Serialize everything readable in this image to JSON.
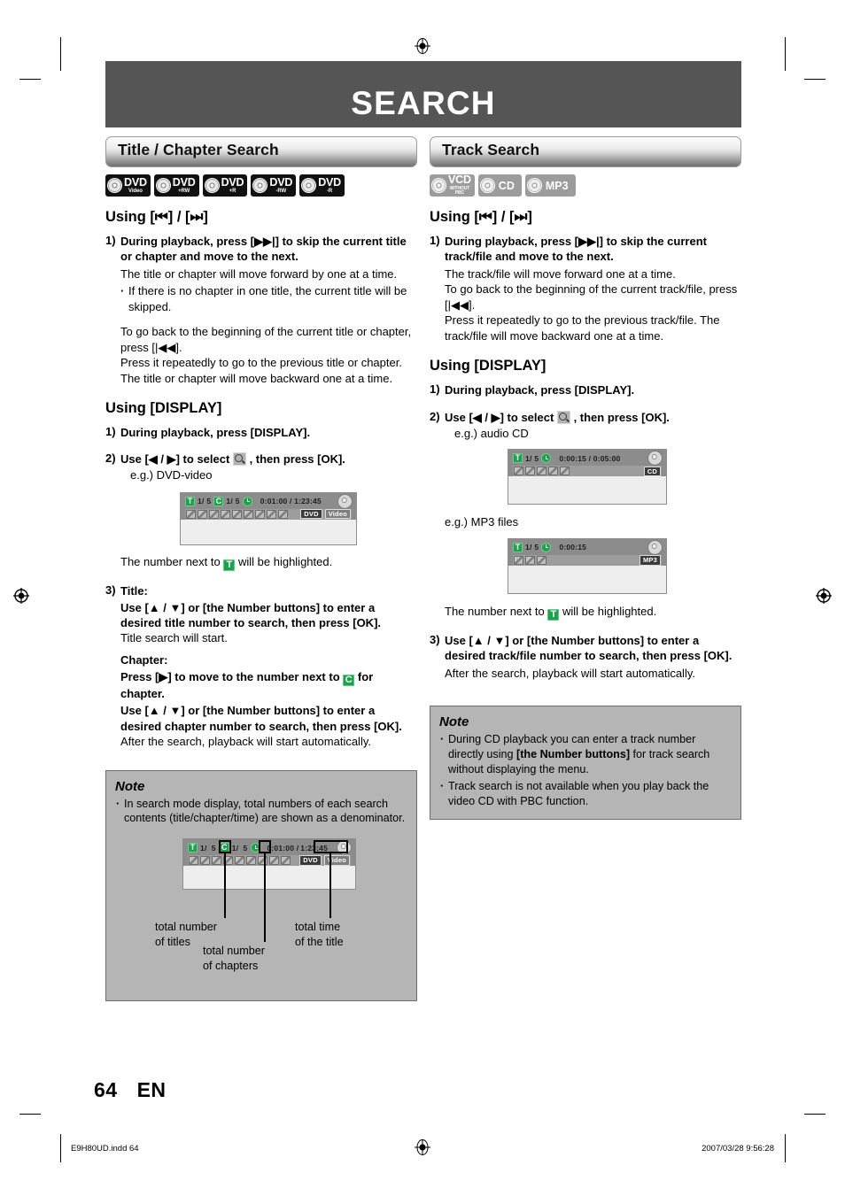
{
  "page": {
    "banner_title": "SEARCH",
    "page_number": "64",
    "language_code": "EN",
    "footer_left": "E9H80UD.indd   64",
    "footer_right": "2007/03/28   9:56:28"
  },
  "left_column": {
    "section_title": "Title / Chapter Search",
    "badges": [
      {
        "main": "DVD",
        "sub": "Video",
        "style": "dark"
      },
      {
        "main": "DVD",
        "sub": "+RW",
        "style": "dark"
      },
      {
        "main": "DVD",
        "sub": "+R",
        "style": "dark"
      },
      {
        "main": "DVD",
        "sub": "-RW",
        "style": "dark"
      },
      {
        "main": "DVD",
        "sub": "-R",
        "style": "dark"
      }
    ],
    "using_skip_heading": "Using [⏮] / [⏭]",
    "step1_num": "1)",
    "step1_bold": "During playback, press [▶▶|] to skip the current title or chapter and move to the next.",
    "step1_p1": "The title or chapter will move forward by one at a time.",
    "step1_bullet": "If there is no chapter in one title, the current title will be skipped.",
    "step1_p2": "To go back to the beginning of the current title or chapter, press [|◀◀].",
    "step1_p3": "Press it repeatedly to go to the previous title or chapter. The title or chapter will move backward one at a time.",
    "using_display_heading": "Using [DISPLAY]",
    "d_step1_num": "1)",
    "d_step1_bold": "During playback, press [DISPLAY].",
    "d_step2_num": "2)",
    "d_step2_bold_a": "Use [◀ / ▶] to select",
    "d_step2_bold_b": ", then press [OK].",
    "d_step2_eg": "e.g.) DVD-video",
    "osd": {
      "t_label": "T",
      "t_value": "1/  5",
      "c_label": "C",
      "c_value": "1/  5",
      "time": "0:01:00 / 1:23:45",
      "badge1": "DVD",
      "badge2": "Video",
      "icon_count": 9
    },
    "highlight_note_a": "The number next to",
    "highlight_note_b": "will be highlighted.",
    "step3_num": "3)",
    "step3_title_label": "Title:",
    "step3_title_bold": "Use [▲ / ▼] or [the Number buttons] to enter a desired title number to search, then press [OK].",
    "step3_title_plain": "Title search will start.",
    "step3_chapter_label": "Chapter:",
    "step3_chapter_bold_a": "Press [▶] to move to the number next to",
    "step3_chapter_bold_b": "for chapter.",
    "step3_chapter_bold2": "Use [▲ / ▼] or [the Number buttons] to enter a desired chapter number to search, then press [OK].",
    "step3_chapter_plain": "After the search, playback will start automatically.",
    "note": {
      "title": "Note",
      "items": [
        "In search mode display, total numbers of each search contents (title/chapter/time) are shown as a denominator."
      ],
      "callouts": {
        "titles": "total number\nof titles",
        "titles_l1": "total number",
        "titles_l2": "of titles",
        "chapters_l1": "total number",
        "chapters_l2": "of chapters",
        "time_l1": "total time",
        "time_l2": "of the title"
      },
      "diagram_osd": {
        "t_label": "T",
        "t_num": "1/",
        "t_total": "5",
        "c_label": "C",
        "c_num": "1/",
        "c_total": "5",
        "time_elapsed": "0:01:00 /",
        "time_total": "1:23:45",
        "badge1": "DVD",
        "badge2": "Video"
      }
    }
  },
  "right_column": {
    "section_title": "Track Search",
    "badges": [
      {
        "main": "VCD",
        "sub": "WITHOUT\nPBC",
        "style": "gray"
      },
      {
        "main": "CD",
        "sub": "",
        "style": "gray"
      },
      {
        "main": "MP3",
        "sub": "",
        "style": "gray"
      }
    ],
    "using_skip_heading": "Using [⏮] / [⏭]",
    "step1_num": "1)",
    "step1_bold": "During playback, press [▶▶|] to skip the current track/file and move to the next.",
    "step1_p1": "The track/file will move forward one at a time.",
    "step1_p2": "To go back to the beginning of the current track/file, press [|◀◀].",
    "step1_p3": "Press it repeatedly to go to the previous track/file. The track/file will move backward one at a time.",
    "using_display_heading": "Using [DISPLAY]",
    "d_step1_num": "1)",
    "d_step1_bold": "During playback, press [DISPLAY].",
    "d_step2_num": "2)",
    "d_step2_bold_a": "Use [◀ / ▶] to select",
    "d_step2_bold_b": ", then press [OK].",
    "eg_cd": "e.g.) audio CD",
    "eg_mp3": "e.g.) MP3 files",
    "osd_cd": {
      "t_label": "T",
      "t_value": "1/  5",
      "time": "0:00:15 / 0:05:00",
      "badge1": "CD",
      "icon_count": 5
    },
    "osd_mp3": {
      "t_label": "T",
      "t_value": "1/  5",
      "time": "0:00:15",
      "badge1": "MP3",
      "icon_count": 3
    },
    "highlight_note_a": "The number next to",
    "highlight_note_b": "will be highlighted.",
    "step3_num": "3)",
    "step3_bold": "Use [▲ / ▼] or [the Number buttons] to enter a desired track/file number to search, then press [OK].",
    "step3_plain": "After the search, playback will start automatically.",
    "note": {
      "title": "Note",
      "item1_a": "During CD playback you can enter a track number directly using",
      "item1_bold": "[the Number buttons]",
      "item1_b": "for track search without displaying the menu.",
      "item2": "Track search is not available when you play back the video CD with PBC function."
    }
  },
  "colors": {
    "banner_bg": "#555555",
    "green_key": "#1aa44a",
    "note_bg": "#b5b5b5",
    "osd_bar": "#8c8c8c"
  }
}
